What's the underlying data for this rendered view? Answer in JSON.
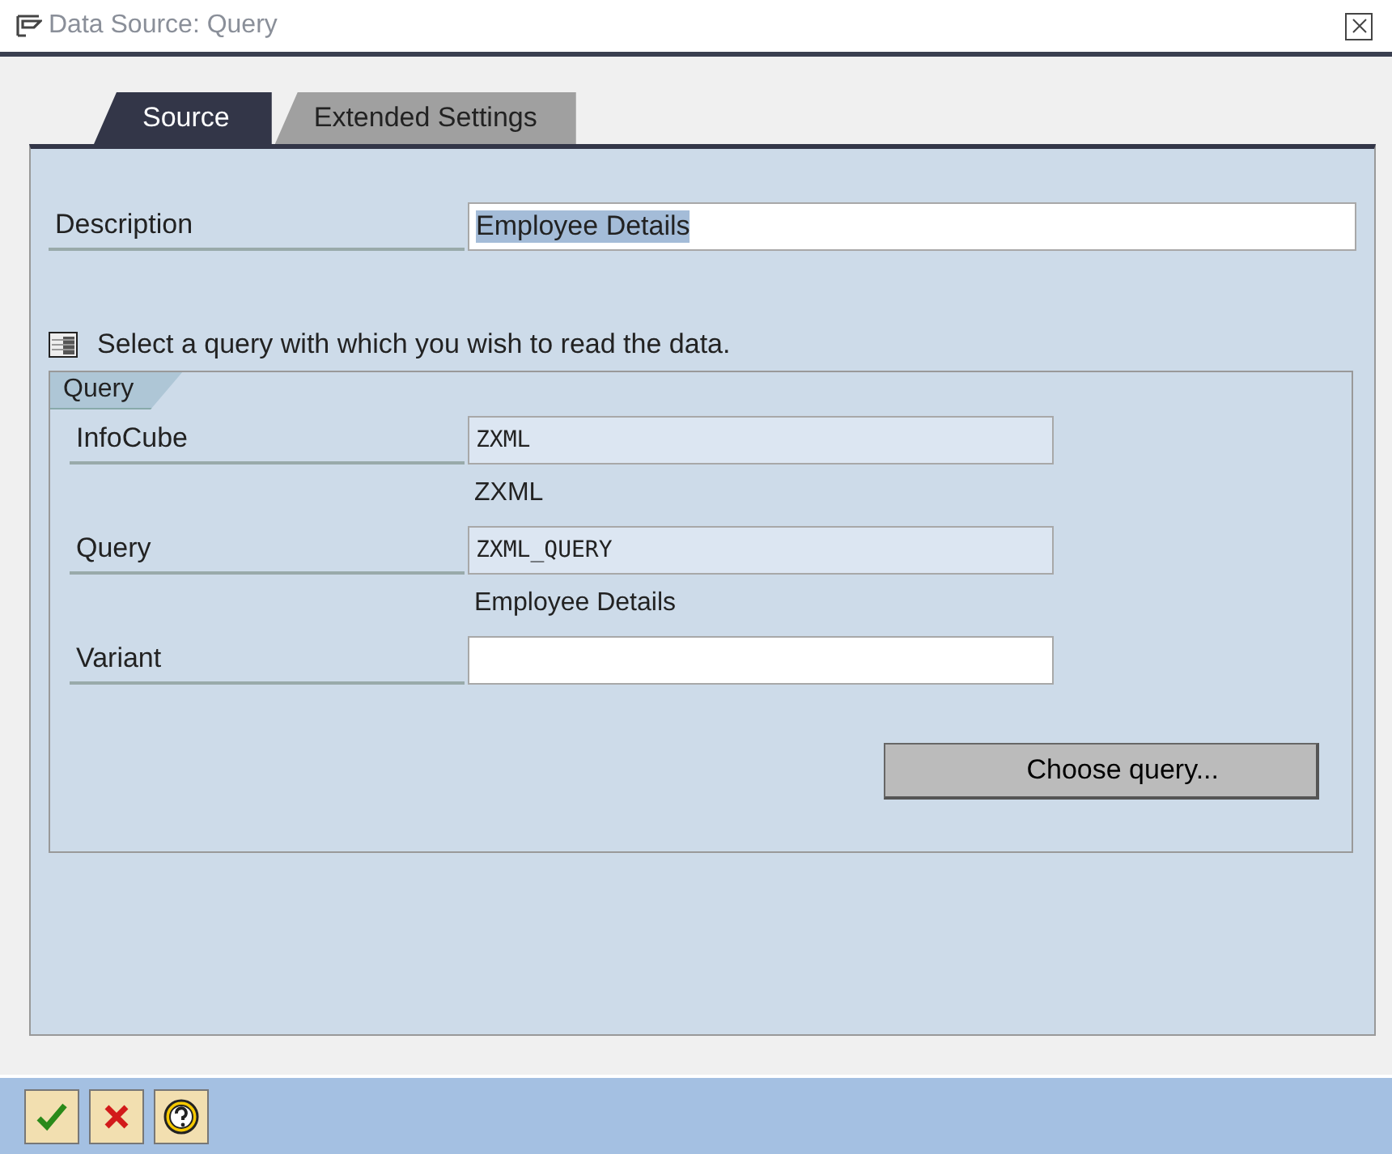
{
  "window": {
    "title": "Data Source: Query"
  },
  "tabs": [
    {
      "label": "Source",
      "selected": true
    },
    {
      "label": "Extended Settings",
      "selected": false
    }
  ],
  "description": {
    "label": "Description",
    "value": "Employee Details",
    "value_selected": true,
    "readonly": false
  },
  "hint": "Select a query with which you wish to read the data.",
  "query_group": {
    "title": "Query",
    "rows": [
      {
        "label": "InfoCube",
        "value": "ZXML",
        "readonly": true,
        "subtext": "ZXML"
      },
      {
        "label": "Query",
        "value": "ZXML_QUERY",
        "readonly": true,
        "subtext": "Employee Details"
      },
      {
        "label": "Variant",
        "value": "",
        "readonly": false
      }
    ],
    "button": "Choose query..."
  },
  "footer_buttons": [
    {
      "kind": "confirm"
    },
    {
      "kind": "cancel"
    },
    {
      "kind": "help"
    }
  ]
}
